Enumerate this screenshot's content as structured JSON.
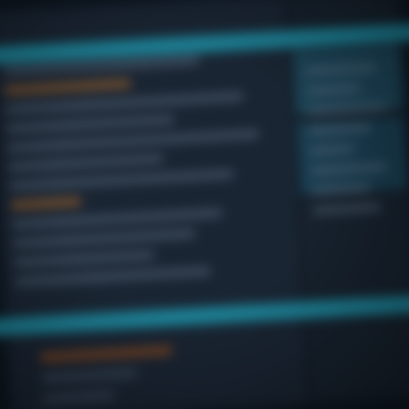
{
  "screen": {
    "state": "out-of-focus",
    "theme": "dark",
    "colors": {
      "background": "#1a2533",
      "panel": "#17222e",
      "highlight": "#1e8fa6",
      "accent": "#8a5a2e"
    }
  }
}
